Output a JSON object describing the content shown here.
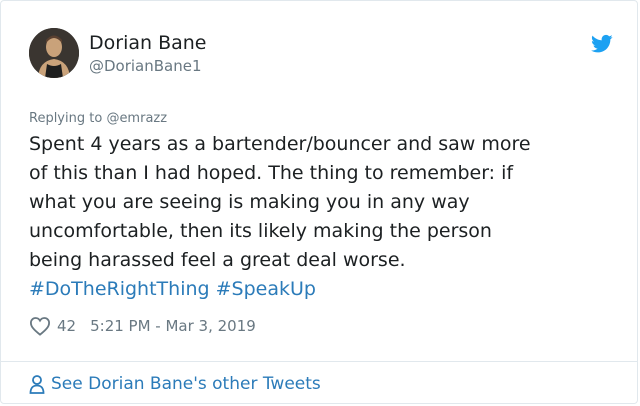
{
  "tweet": {
    "author": {
      "name": "Dorian Bane",
      "handle": "@DorianBane1"
    },
    "reply_prefix": "Replying to ",
    "reply_to": "@emrazz",
    "text_line1": "Spent 4 years as a bartender/bouncer and saw more",
    "text_line2": "of this than I had hoped. The thing to remember: if",
    "text_line3": "what you are seeing is making you in any way",
    "text_line4": "uncomfortable, then its likely making the person",
    "text_line5": "being harassed feel a great deal worse.",
    "hashtags": [
      "#DoTheRightThing",
      "#SpeakUp"
    ],
    "likes": "42",
    "timestamp": "5:21 PM - Mar 3, 2019",
    "footer_link": "See Dorian Bane's other Tweets"
  },
  "colors": {
    "link": "#2b7bb9",
    "muted": "#697882",
    "text": "#1c2022",
    "twitter_blue": "#1da1f2"
  },
  "icons": {
    "brand": "twitter-bird-icon",
    "like": "heart-icon",
    "profile": "person-icon"
  }
}
